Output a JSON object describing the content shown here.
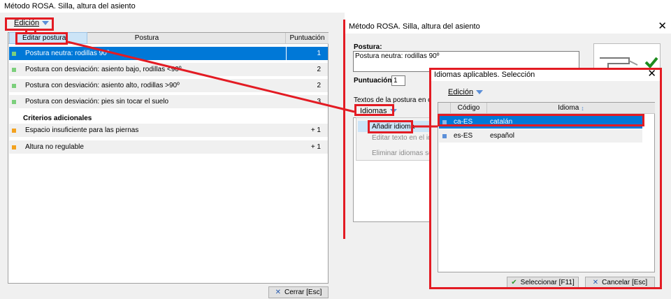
{
  "left_window": {
    "title": "Método ROSA. Silla, altura del asiento",
    "menu_label": "Edición",
    "popup_item": "Editar postura",
    "columns": {
      "postura": "Postura",
      "puntuacion": "Puntuación"
    },
    "rows": [
      {
        "label": "Postura neutra: rodillas 90º",
        "score": "1"
      },
      {
        "label": "Postura con desviación: asiento bajo, rodillas <90º",
        "score": "2"
      },
      {
        "label": "Postura con desviación: asiento alto, rodillas >90º",
        "score": "2"
      },
      {
        "label": "Postura con desviación: pies sin tocar el suelo",
        "score": "3"
      }
    ],
    "section_header": "Criterios adicionales",
    "extra_rows": [
      {
        "label": "Espacio insuficiente para las piernas",
        "score": "+ 1"
      },
      {
        "label": "Altura no regulable",
        "score": "+ 1"
      }
    ],
    "close_button": "Cerrar [Esc]"
  },
  "middle_window": {
    "title": "Método ROSA. Silla, altura del asiento",
    "postura_label": "Postura:",
    "postura_value": "Postura neutra: rodillas 90º",
    "puntuacion_label": "Puntuación:",
    "puntuacion_value": "1",
    "textos_label": "Textos de la postura en otros idi",
    "idiomas_button": "Idiomas",
    "context_menu": [
      "Añadir idioma",
      "Editar texto en el idiom",
      "Eliminar idiomas selecc"
    ]
  },
  "dialog": {
    "title": "Idiomas aplicables. Selección",
    "menu_label": "Edición",
    "columns": {
      "codigo": "Código",
      "idioma": "Idioma"
    },
    "rows": [
      {
        "code": "ca-ES",
        "language": "catalán"
      },
      {
        "code": "es-ES",
        "language": "español"
      }
    ],
    "select_button": "Seleccionar [F11]",
    "cancel_button": "Cancelar [Esc]"
  },
  "colors": {
    "accent": "#0078d7",
    "annotation": "#e31b23",
    "green_marker": "#7ccf7c",
    "orange_marker": "#f3a21f",
    "blue_marker": "#5b8fd8"
  }
}
